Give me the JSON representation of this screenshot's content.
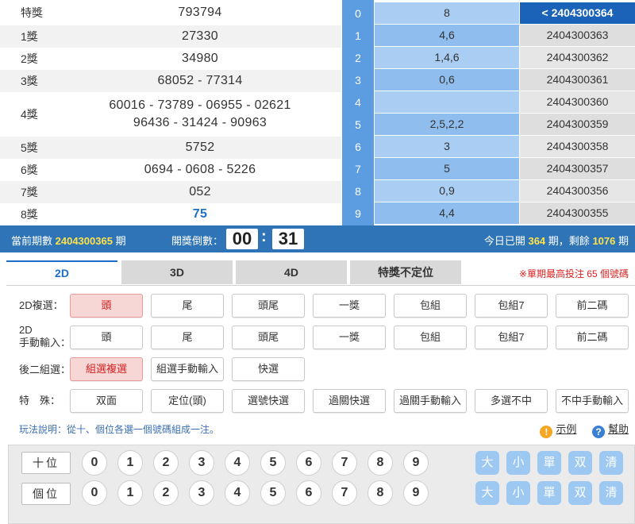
{
  "prizes": [
    {
      "label": "特獎",
      "value": "793794"
    },
    {
      "label": "1獎",
      "value": "27330"
    },
    {
      "label": "2獎",
      "value": "34980"
    },
    {
      "label": "3獎",
      "value": "68052 - 77314"
    },
    {
      "label": "4獎",
      "value": "60016 - 73789 - 06955 - 02621",
      "value2": "96436 - 31424 - 90963"
    },
    {
      "label": "5獎",
      "value": "5752"
    },
    {
      "label": "6獎",
      "value": "0694 - 0608 - 5226"
    },
    {
      "label": "7獎",
      "value": "052"
    },
    {
      "label": "8獎",
      "value": "75"
    }
  ],
  "tails": [
    {
      "idx": "0",
      "nums": "8"
    },
    {
      "idx": "1",
      "nums": "4,6"
    },
    {
      "idx": "2",
      "nums": "1,4,6"
    },
    {
      "idx": "3",
      "nums": "0,6"
    },
    {
      "idx": "4",
      "nums": ""
    },
    {
      "idx": "5",
      "nums": "2,5,2,2"
    },
    {
      "idx": "6",
      "nums": "3"
    },
    {
      "idx": "7",
      "nums": "5"
    },
    {
      "idx": "8",
      "nums": "0,9"
    },
    {
      "idx": "9",
      "nums": "4,4"
    }
  ],
  "periods": [
    "2404300364",
    "2404300363",
    "2404300362",
    "2404300361",
    "2404300360",
    "2404300359",
    "2404300358",
    "2404300357",
    "2404300356",
    "2404300355"
  ],
  "period_arrow": "<",
  "info": {
    "current_label": "當前期數",
    "current_period": "2404300365",
    "period_unit": "期",
    "countdown_label": "開獎倒數：",
    "countdown_min": "00",
    "countdown_sep": ":",
    "countdown_sec": "31",
    "today_label": "今日已開",
    "today_count": "364",
    "remain_label": "期，剩餘",
    "remain_count": "1076",
    "remain_unit": "期"
  },
  "tabs": [
    "2D",
    "3D",
    "4D",
    "特獎不定位"
  ],
  "warning": "※單期最高投注 65 個號碼",
  "rows": [
    {
      "label": "2D複選：",
      "buttons": [
        "頭",
        "尾",
        "頭尾",
        "一獎",
        "包組",
        "包組7",
        "前二碼"
      ]
    },
    {
      "label": "2D",
      "label2": "手動輸入：",
      "buttons": [
        "頭",
        "尾",
        "頭尾",
        "一獎",
        "包組",
        "包組7",
        "前二碼"
      ]
    },
    {
      "label": "後二組選：",
      "buttons": [
        "組選複選",
        "組選手動輸入",
        "快選"
      ]
    },
    {
      "label": "特　殊：",
      "buttons": [
        "双面",
        "定位(頭)",
        "選號快選",
        "過關快選",
        "過關手動輸入",
        "多選不中",
        "不中手動輸入"
      ]
    }
  ],
  "help_text": "玩法說明：從十、個位各選一個號碼組成一注。",
  "links": {
    "example": "示例",
    "help": "幫助",
    "warn_icon": "!",
    "help_icon": "?"
  },
  "positions": [
    "十位",
    "個位"
  ],
  "digits": [
    "0",
    "1",
    "2",
    "3",
    "4",
    "5",
    "6",
    "7",
    "8",
    "9"
  ],
  "quick": [
    "大",
    "小",
    "單",
    "双",
    "清"
  ],
  "colors": {
    "accent": "#1c6ec6",
    "bar": "#2f74b6",
    "highlight": "#ffe24a",
    "selected": "#d42020"
  }
}
